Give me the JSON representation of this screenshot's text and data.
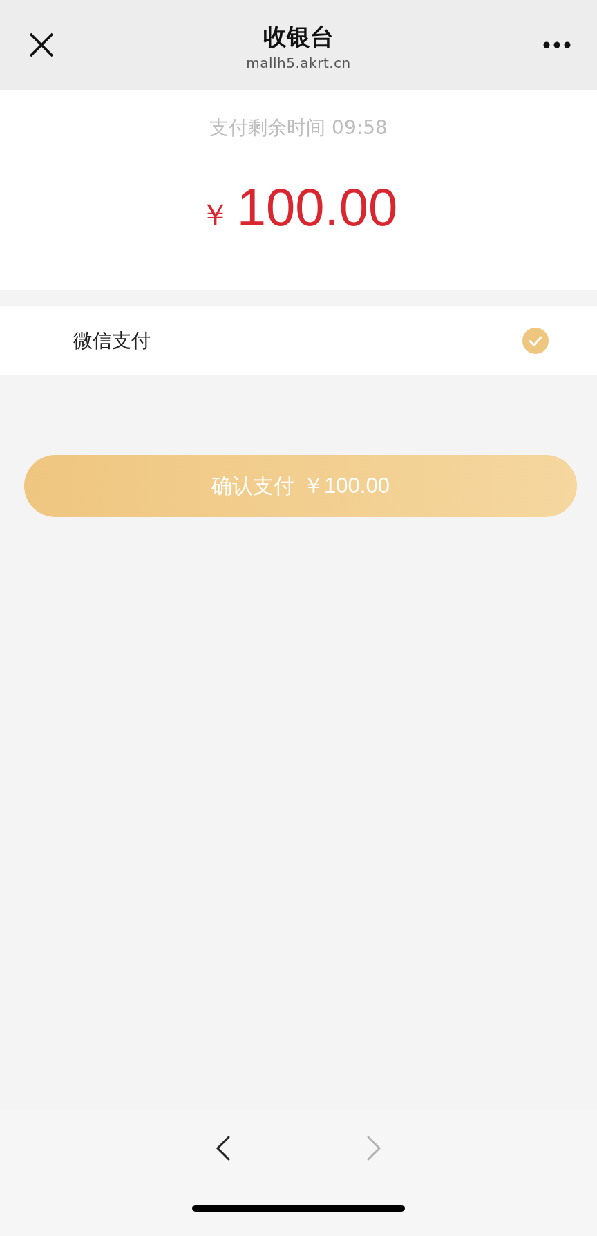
{
  "header": {
    "title": "收银台",
    "url": "mallh5.akrt.cn"
  },
  "countdown": "支付剩余时间 09:58",
  "amount": {
    "currency": "￥",
    "value": "100.00"
  },
  "payment_methods": [
    {
      "label": "微信支付",
      "selected": true
    }
  ],
  "confirm_button": {
    "label": "确认支付",
    "amount": "￥100.00"
  },
  "nav": [
    {
      "kind": "back",
      "disabled": false
    },
    {
      "kind": "forward",
      "disabled": true
    }
  ]
}
